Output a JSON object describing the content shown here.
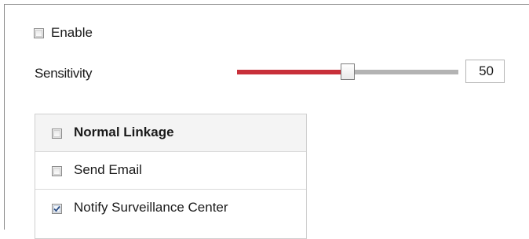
{
  "enable": {
    "label": "Enable",
    "checked": false
  },
  "sensitivity": {
    "label": "Sensitivity",
    "value": "50",
    "fraction": 0.5
  },
  "slider_colors": {
    "fill": "#c8303a",
    "track": "#b3b3b3"
  },
  "linkage": {
    "header": {
      "label": "Normal Linkage",
      "checked": false
    },
    "items": [
      {
        "label": "Send Email",
        "checked": false
      },
      {
        "label": "Notify Surveillance Center",
        "checked": true
      }
    ]
  }
}
